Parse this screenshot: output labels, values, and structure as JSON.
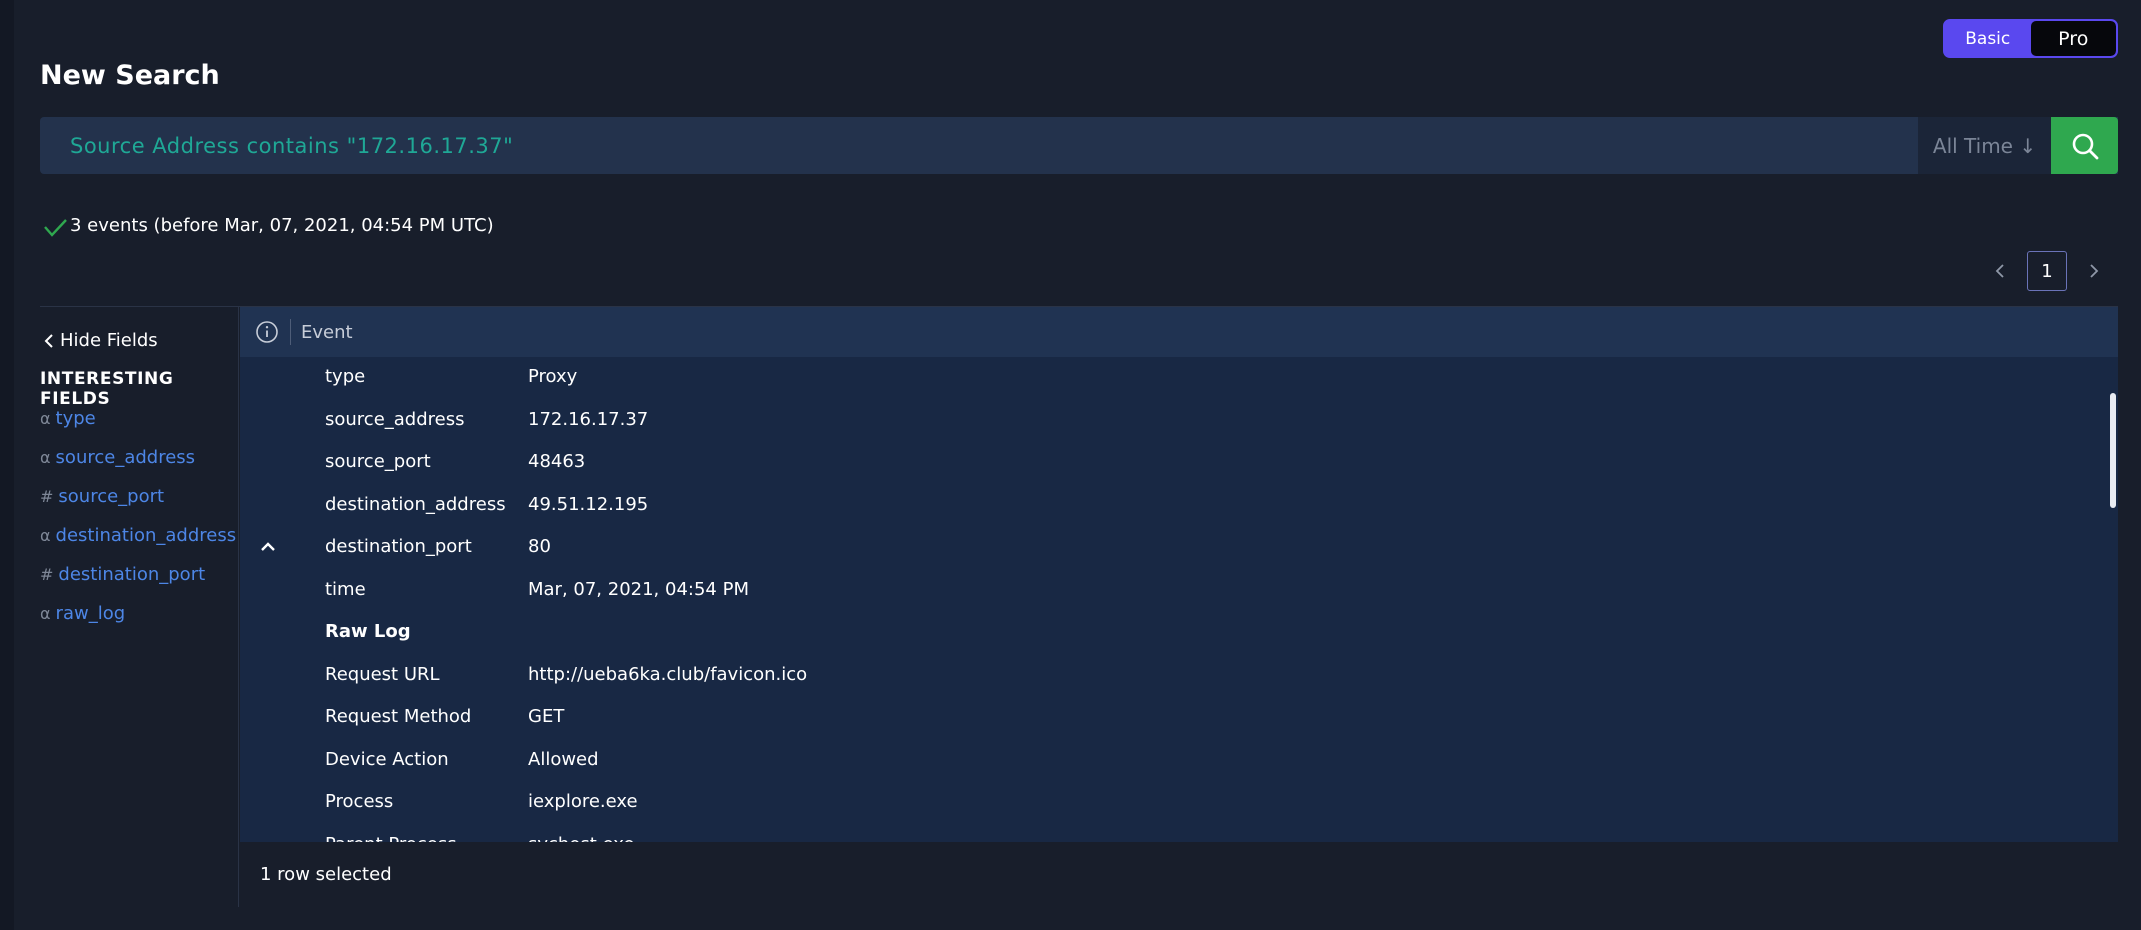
{
  "mode_toggle": {
    "basic": "Basic",
    "pro": "Pro",
    "selected": "Pro"
  },
  "page_title": "New Search",
  "search": {
    "query": "Source Address contains \"172.16.17.37\"",
    "time_range": "All Time ↓"
  },
  "status": {
    "text": "3 events (before Mar, 07, 2021, 04:54 PM UTC)"
  },
  "pagination": {
    "current_page": "1"
  },
  "sidebar": {
    "hide_label": "Hide Fields",
    "section_title": "INTERESTING FIELDS",
    "fields": [
      {
        "symbol": "α",
        "name": "type"
      },
      {
        "symbol": "α",
        "name": "source_address"
      },
      {
        "symbol": "#",
        "name": "source_port"
      },
      {
        "symbol": "α",
        "name": "destination_address"
      },
      {
        "symbol": "#",
        "name": "destination_port"
      },
      {
        "symbol": "α",
        "name": "raw_log"
      }
    ]
  },
  "event_panel": {
    "header": "Event",
    "rows": [
      {
        "key": "type",
        "value": "Proxy"
      },
      {
        "key": "source_address",
        "value": "172.16.17.37"
      },
      {
        "key": "source_port",
        "value": "48463"
      },
      {
        "key": "destination_address",
        "value": "49.51.12.195"
      },
      {
        "key": "destination_port",
        "value": "80"
      },
      {
        "key": "time",
        "value": "Mar, 07, 2021, 04:54 PM"
      },
      {
        "key": "Raw Log",
        "value": ""
      },
      {
        "key": "Request URL",
        "value": "http://ueba6ka.club/favicon.ico"
      },
      {
        "key": "Request Method",
        "value": "GET"
      },
      {
        "key": "Device Action",
        "value": "Allowed"
      },
      {
        "key": "Process",
        "value": "iexplore.exe"
      },
      {
        "key": "Parent Process",
        "value": "svchost.exe"
      }
    ]
  },
  "footer": {
    "selection": "1 row selected"
  },
  "colors": {
    "accent": "#5a48ef",
    "search_button": "#2fa84f",
    "field_link": "#4d86e6",
    "query_text": "#1fa896"
  },
  "icons": [
    "search-icon",
    "check-icon",
    "chevron-left-icon",
    "chevron-right-icon",
    "info-icon",
    "chevron-up-icon"
  ]
}
